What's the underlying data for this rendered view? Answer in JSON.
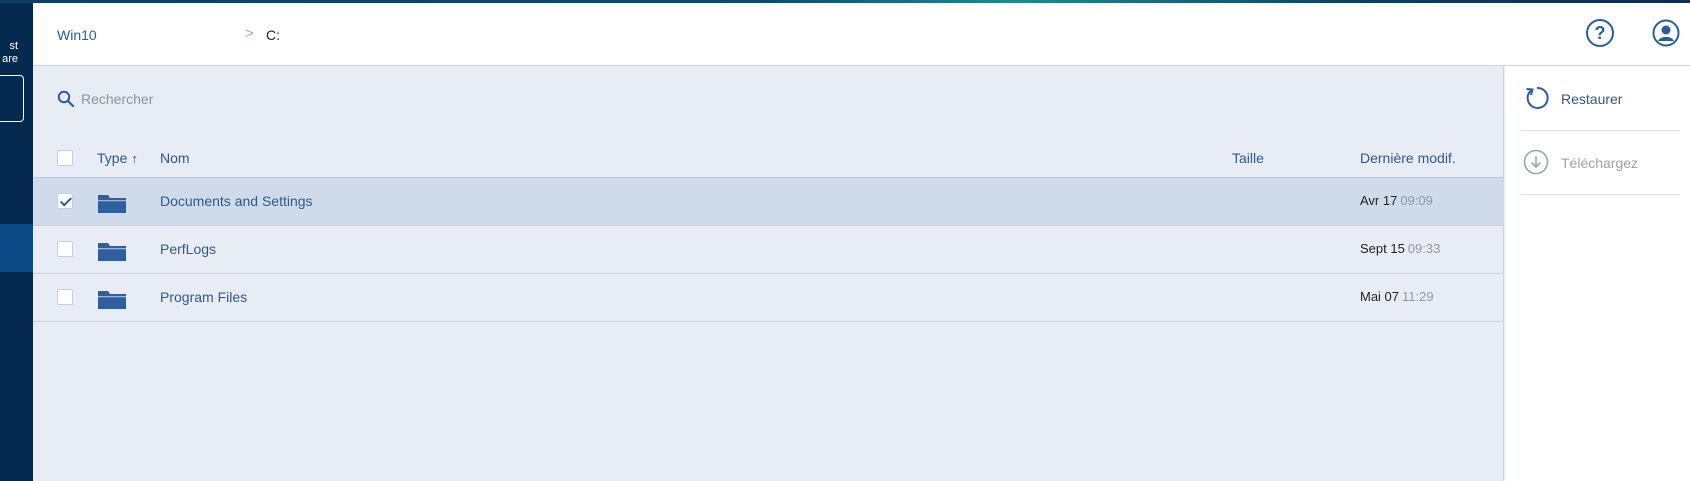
{
  "sidebar": {
    "brand_line1": "st",
    "brand_line2": "are"
  },
  "header": {
    "breadcrumb_root": "Win10",
    "breadcrumb_separator": ">",
    "breadcrumb_current": "C:",
    "help_icon": "help-icon",
    "user_icon": "user-icon"
  },
  "search": {
    "placeholder": "Rechercher",
    "value": ""
  },
  "table": {
    "headers": {
      "type": "Type",
      "type_sort_icon": "↑",
      "name": "Nom",
      "size": "Taille",
      "modified": "Dernière modif."
    },
    "rows": [
      {
        "name": "Documents and Settings",
        "date": "Avr 17",
        "time": "09:09",
        "selected": true,
        "icon": "folder-icon"
      },
      {
        "name": "PerfLogs",
        "date": "Sept 15",
        "time": "09:33",
        "selected": false,
        "icon": "folder-icon"
      },
      {
        "name": "Program Files",
        "date": "Mai 07",
        "time": "11:29",
        "selected": false,
        "icon": "folder-icon"
      }
    ]
  },
  "actions": {
    "restore_label": "Restaurer",
    "download_label": "Téléchargez"
  },
  "colors": {
    "accent": "#2d5a8c",
    "nav_bg": "#062a4f",
    "selected_row": "#cfdbeb",
    "folder": "#2f5f9e"
  }
}
